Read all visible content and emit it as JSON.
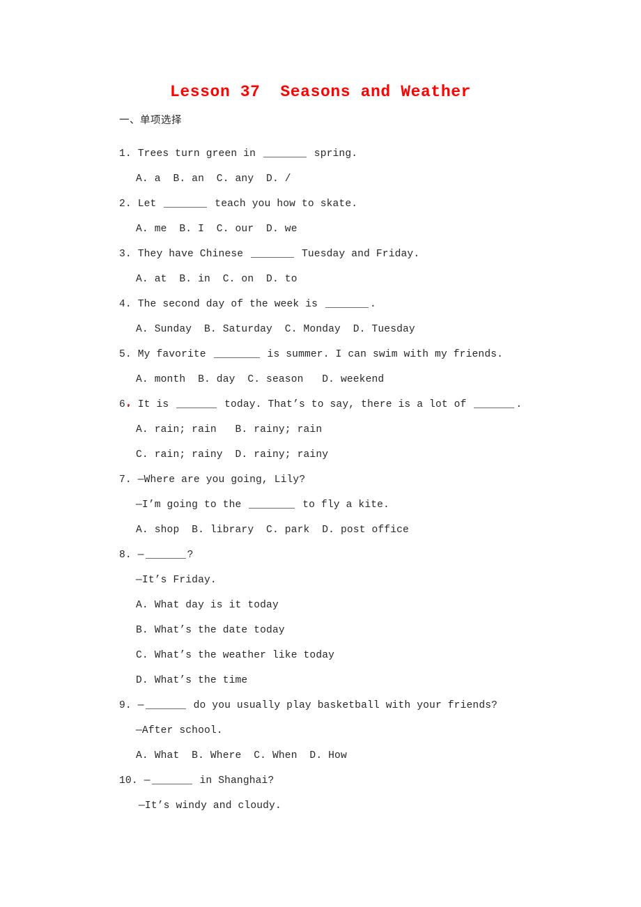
{
  "document": {
    "title": "Lesson 37  Seasons and Weather",
    "title_color": "#fe0000",
    "background_color": "#ffffff",
    "page_text_color": "#282828"
  },
  "section": {
    "heading": "一、单项选择"
  },
  "questions": [
    {
      "number": "1.",
      "stem_before": " Trees turn green in ",
      "stem_after": " spring.",
      "options_lines": [
        "A. a  B. an  C. any  D. /"
      ]
    },
    {
      "number": "2.",
      "stem_before": " Let ",
      "stem_after": " teach you how to skate.",
      "options_lines": [
        "A. me  B. I  C. our  D. we"
      ]
    },
    {
      "number": "3.",
      "stem_before": " They have Chinese ",
      "stem_after": " Tuesday and Friday.",
      "options_lines": [
        "A. at  B. in  C. on  D. to"
      ]
    },
    {
      "number": "4.",
      "stem_before": " The second day of the week is ",
      "stem_after": ".",
      "options_lines": [
        "A. Sunday  B. Saturday  C. Monday  D. Tuesday"
      ]
    },
    {
      "number": "5.",
      "stem_before": " My favorite ",
      "stem_after": " is summer. I can swim with my friends.",
      "options_lines": [
        "A. month  B. day  C. season   D. weekend"
      ]
    },
    {
      "number": "6.",
      "stem_before": " It is ",
      "stem_mid": " today. That’s to say, there is a lot of ",
      "stem_after": ".",
      "options_lines": [
        "A. rain; rain   B. rainy; rain",
        "C. rain; rainy  D. rainy; rainy"
      ]
    },
    {
      "number": "7.",
      "stem_line": " —Where are you going, Lily?",
      "reply_before": "—I’m going to the ",
      "reply_after": " to fly a kite.",
      "options_lines": [
        "A. shop  B. library  C. park  D. post office"
      ]
    },
    {
      "number": "8.",
      "stem_before": " —",
      "stem_after": "?",
      "reply_line": "—It’s Friday.",
      "options_lines": [
        "A. What day is it today",
        "B. What’s the date today",
        "C. What’s the weather like today",
        "D. What’s the time"
      ]
    },
    {
      "number": "9.",
      "stem_before": " —",
      "stem_after": " do you usually play basketball with your friends?",
      "reply_line": "—After school.",
      "options_lines": [
        "A. What  B. Where  C. When  D. How"
      ]
    },
    {
      "number": "10.",
      "stem_before": " —",
      "stem_after": " in Shanghai?",
      "reply_line": "—It’s windy and cloudy.",
      "options_lines": []
    }
  ]
}
